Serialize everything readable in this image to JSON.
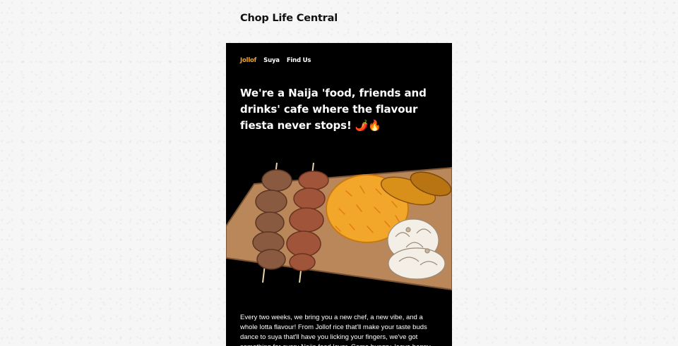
{
  "site": {
    "title": "Chop Life Central"
  },
  "nav": {
    "items": [
      "Jollof",
      "Suya",
      "Find Us"
    ],
    "active": 0
  },
  "hero": {
    "headline": "We're a Naija 'food, friends and drinks' cafe where the flavour fiesta never stops! 🌶️🔥"
  },
  "intro": {
    "text": "Every two weeks, we bring you a new chef, a new vibe, and a whole lotta flavour! From Jollof rice that'll make your taste buds dance to suya that'll have you licking your fingers, we've got something for every Naija food lover. Come hungry, leave happy"
  },
  "colors": {
    "accent": "#f5a21b",
    "card": "#000000",
    "text": "#ffffff"
  }
}
